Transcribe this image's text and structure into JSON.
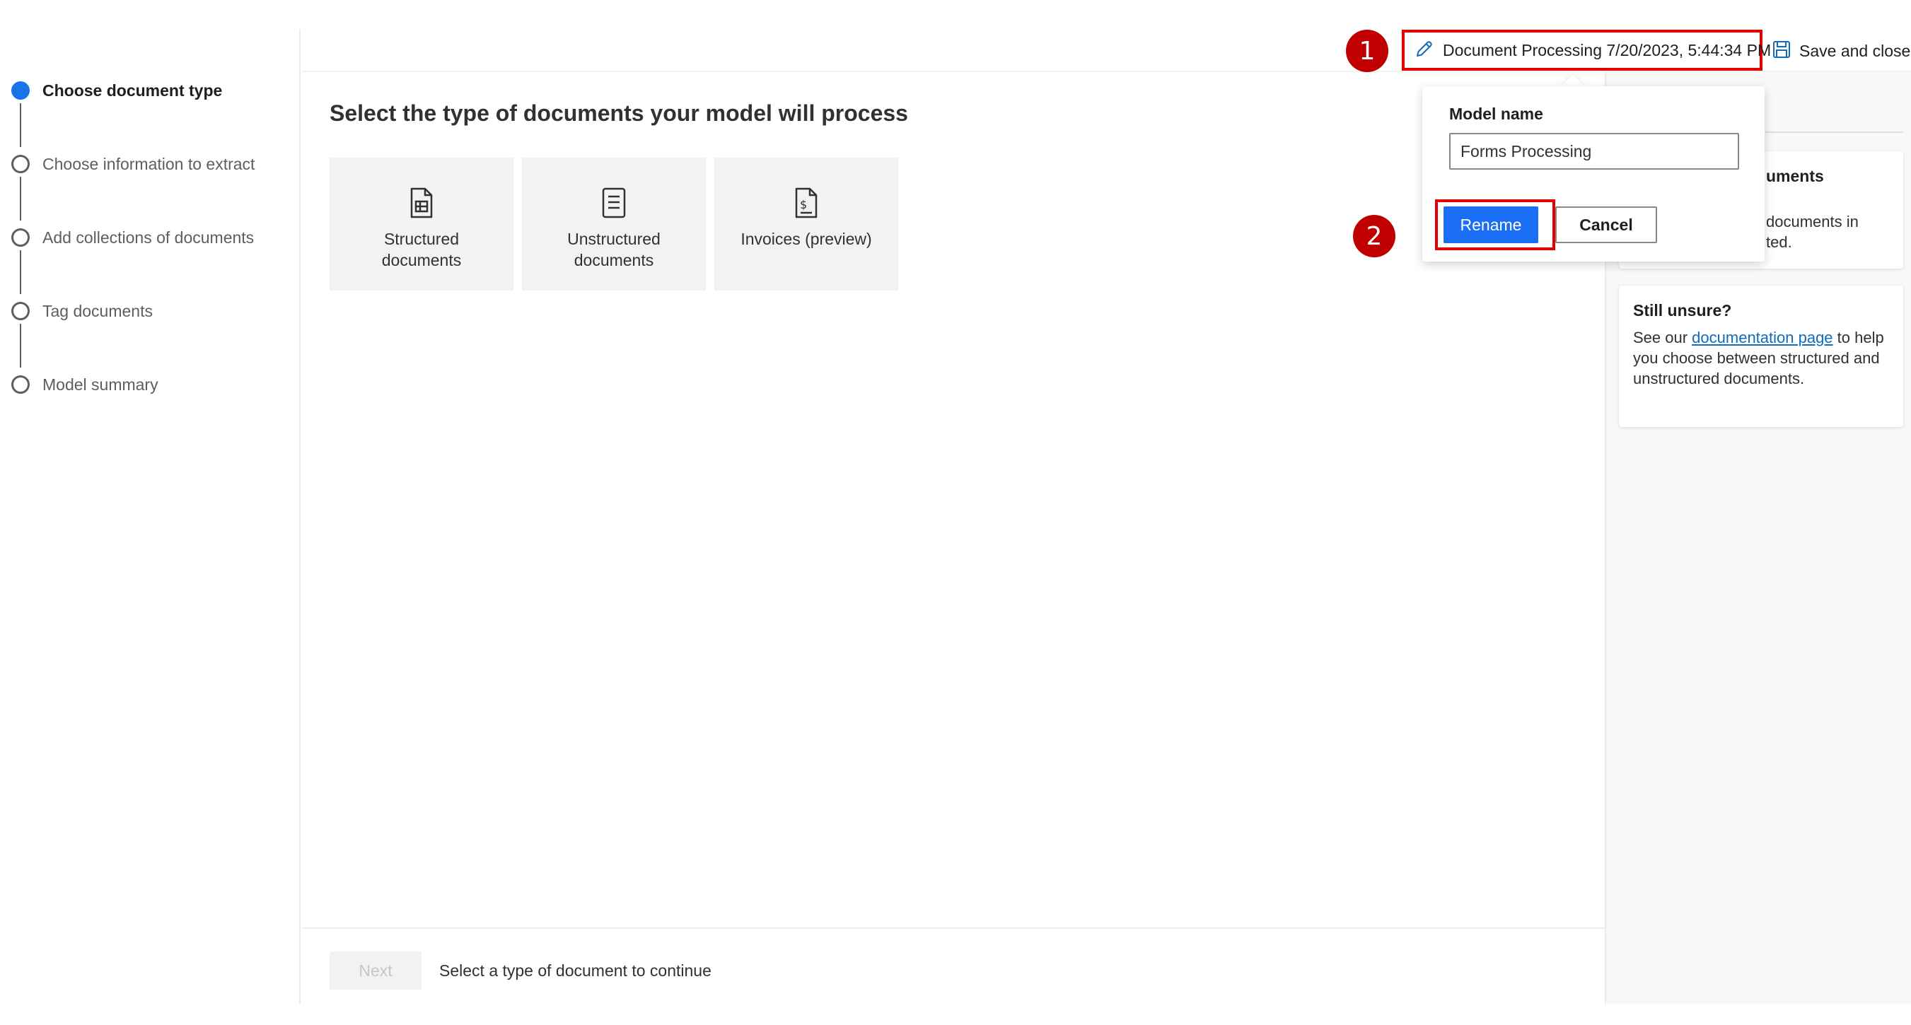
{
  "stepper": {
    "steps": [
      {
        "label": "Choose document type",
        "active": true
      },
      {
        "label": "Choose information to extract",
        "active": false
      },
      {
        "label": "Add collections of documents",
        "active": false
      },
      {
        "label": "Tag documents",
        "active": false
      },
      {
        "label": "Model summary",
        "active": false
      }
    ]
  },
  "topbar": {
    "model_title": "Document Processing 7/20/2023, 5:44:34 PM",
    "save_label": "Save and close"
  },
  "annotations": {
    "badge1": "1",
    "badge2": "2"
  },
  "main": {
    "heading": "Select the type of documents your model will process",
    "tiles": [
      {
        "label": "Structured documents",
        "icon": "structured-document-icon"
      },
      {
        "label": "Unstructured documents",
        "icon": "unstructured-document-icon"
      },
      {
        "label": "Invoices (preview)",
        "icon": "invoice-icon"
      }
    ]
  },
  "footer": {
    "next_label": "Next",
    "hint": "Select a type of document to continue"
  },
  "rename_callout": {
    "label": "Model name",
    "input_value": "Forms Processing",
    "rename_label": "Rename",
    "cancel_label": "Cancel"
  },
  "help": {
    "card1_title_fragment": "uments",
    "card1_line1_fragment": "documents in",
    "card1_line2_fragment": "ted.",
    "card2_title": "Still unsure?",
    "card2_prefix": "See our ",
    "card2_link": "documentation page",
    "card2_suffix": " to help you choose between structured and unstructured documents."
  },
  "colors": {
    "accent": "#1a6ef5",
    "highlight": "#e00000",
    "badge": "#c00000"
  }
}
